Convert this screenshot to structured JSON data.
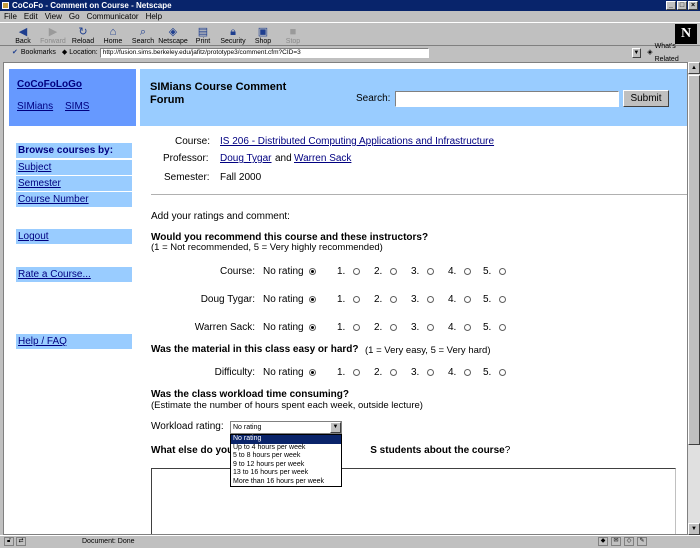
{
  "window": {
    "title": "CoCoFo - Comment on Course - Netscape",
    "controls": [
      "_",
      "□",
      "×"
    ]
  },
  "menu": [
    "File",
    "Edit",
    "View",
    "Go",
    "Communicator",
    "Help"
  ],
  "toolbar": [
    {
      "label": "Back",
      "icon": "back-arrow-icon",
      "enabled": true
    },
    {
      "label": "Forward",
      "icon": "forward-arrow-icon",
      "enabled": false
    },
    {
      "label": "Reload",
      "icon": "reload-icon",
      "enabled": true
    },
    {
      "label": "Home",
      "icon": "home-icon",
      "enabled": true
    },
    {
      "label": "Search",
      "icon": "search-icon",
      "enabled": true
    },
    {
      "label": "Netscape",
      "icon": "netscape-icon",
      "enabled": true
    },
    {
      "label": "Print",
      "icon": "print-icon",
      "enabled": true
    },
    {
      "label": "Security",
      "icon": "security-icon",
      "enabled": true
    },
    {
      "label": "Shop",
      "icon": "shop-icon",
      "enabled": true
    },
    {
      "label": "Stop",
      "icon": "stop-icon",
      "enabled": false
    }
  ],
  "location": {
    "bookmarks_label": "Bookmarks",
    "location_label": "Location:",
    "url": "http://fusion.sims.berkeley.edu/jafitz/prototype3/comment.cfm?CID=3",
    "whats_related": "What's Related"
  },
  "status": {
    "text": "Document: Done"
  },
  "brand": {
    "logo_text": "CoCoFoLoGo",
    "links": [
      "SIMians",
      "SIMS"
    ],
    "forum_title": "SIMians Course Comment Forum"
  },
  "search": {
    "label": "Search:",
    "value": "",
    "button": "Submit"
  },
  "sidebar": {
    "heading": "Browse courses by:",
    "browse_items": [
      "Subject",
      "Semester",
      "Course Number"
    ],
    "logout": "Logout",
    "rate": "Rate a Course...",
    "help": "Help / FAQ"
  },
  "course_info": {
    "course_label": "Course:",
    "course_value": "IS 206 - Distributed Computing Applications and Infrastructure",
    "professor_label": "Professor:",
    "professors": [
      "Doug Tygar",
      "Warren Sack"
    ],
    "and_text": "and",
    "semester_label": "Semester:",
    "semester_value": "Fall 2000"
  },
  "form": {
    "intro": "Add your ratings and comment:",
    "q1_title": "Would you recommend this course and these instructors?",
    "q1_note": "(1 = Not recommended, 5 = Very highly recommended)",
    "no_rating": "No rating",
    "options": [
      "1.",
      "2.",
      "3.",
      "4.",
      "5."
    ],
    "q1_rows": [
      "Course:",
      "Doug Tygar:",
      "Warren Sack:"
    ],
    "q2_title": "Was the material in this class easy or hard?",
    "q2_note": "(1 = Very easy, 5 = Very hard)",
    "q2_rows": [
      "Difficulty:"
    ],
    "q3_title": "Was the class workload time consuming?",
    "q3_note": "(Estimate the number of hours spent each week, outside lecture)",
    "workload_label": "Workload rating:",
    "workload_selected": "No rating",
    "workload_options": [
      "No rating",
      "Up to 4 hours per week",
      "5 to 8 hours per week",
      "9 to 12 hours per week",
      "13 to 16 hours per week",
      "More than 16 hours per week"
    ],
    "q4_title_start": "What else do you",
    "q4_title_end": "S students about the course",
    "q4_qmark": "?"
  }
}
